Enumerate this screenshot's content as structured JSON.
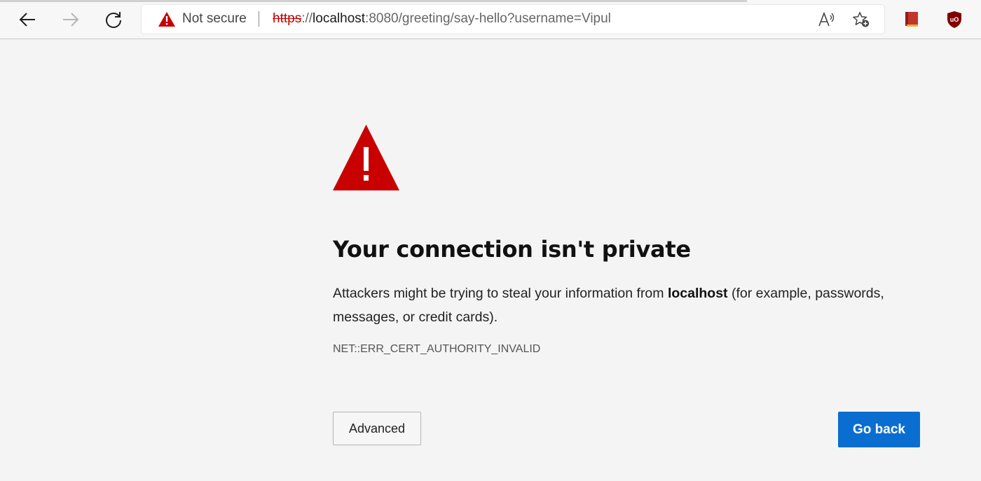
{
  "browser": {
    "toolbar": {
      "back_icon": "arrow-left-icon",
      "forward_icon": "arrow-right-icon",
      "refresh_icon": "refresh-icon"
    },
    "address_bar": {
      "security_label": "Not secure",
      "security_icon": "warning-triangle-icon",
      "url_scheme": "https",
      "url_separator": "://",
      "url_host": "localhost",
      "url_rest": ":8080/greeting/say-hello?username=Vipul",
      "read_aloud_icon": "read-aloud-icon",
      "favorites_icon": "add-favorite-icon"
    },
    "extensions": [
      "bookmark-extension-icon",
      "ublock-origin-icon"
    ]
  },
  "page": {
    "warning_icon": "warning-triangle-icon",
    "headline": "Your connection isn't private",
    "message_before": "Attackers might be trying to steal your information from ",
    "message_host": "localhost",
    "message_after": " (for example, passwords, messages, or credit cards).",
    "error_code": "NET::ERR_CERT_AUTHORITY_INVALID",
    "advanced_button": "Advanced",
    "go_back_button": "Go back"
  },
  "colors": {
    "warning_red": "#c80000",
    "primary_blue": "#0a6ed1",
    "page_background": "#f4f4f4"
  }
}
